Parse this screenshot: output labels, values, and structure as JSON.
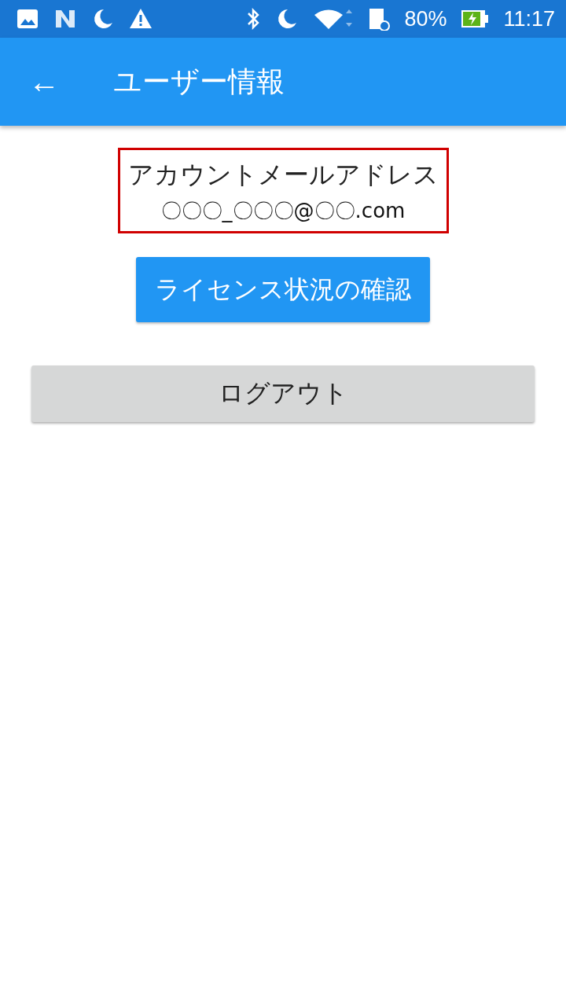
{
  "status_bar": {
    "battery": "80%",
    "time": "11:17"
  },
  "app_bar": {
    "back": "←",
    "title": "ユーザー情報"
  },
  "account": {
    "label": "アカウントメールアドレス",
    "email": "〇〇〇_〇〇〇@〇〇.com"
  },
  "buttons": [
    {
      "kind": "primary",
      "label": "ライセンス状況の確認"
    },
    {
      "kind": "secondary",
      "label": "ログアウト"
    }
  ]
}
